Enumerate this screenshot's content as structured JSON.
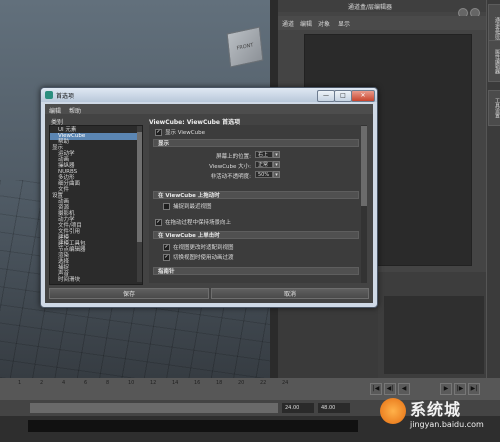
{
  "maya": {
    "outliner_title": "通道盒/层编辑器",
    "outliner_menu": [
      "通道",
      "编辑",
      "对象",
      "显示"
    ],
    "side_tabs": [
      "通道盒/层编辑器",
      "属性编辑器",
      "工具设置"
    ],
    "viewcube_face": "FRONT",
    "timeline_ticks": [
      "1",
      "2",
      "4",
      "6",
      "8",
      "10",
      "12",
      "14",
      "16",
      "18",
      "20",
      "22",
      "24"
    ],
    "range_end": "24.00",
    "range_max": "48.00",
    "playback_buttons": [
      "|◀",
      "◀|",
      "◀",
      "▶",
      "|▶",
      "▶|"
    ]
  },
  "watermark": {
    "site": "系统城",
    "url": "jingyan.baidu.com"
  },
  "dialog": {
    "title": "首选项",
    "menu": [
      "编辑",
      "帮助"
    ],
    "titlebar_buttons": {
      "minimize": "—",
      "maximize": "□",
      "close": "✕"
    },
    "category_label": "类别",
    "categories": [
      {
        "label": "UI 元素",
        "indent": 1,
        "selected": false
      },
      {
        "label": "ViewCube",
        "indent": 1,
        "selected": true
      },
      {
        "label": "帮助",
        "indent": 1,
        "selected": false
      },
      {
        "label": "显示",
        "indent": 0,
        "selected": false
      },
      {
        "label": "运动学",
        "indent": 1,
        "selected": false
      },
      {
        "label": "动画",
        "indent": 1,
        "selected": false
      },
      {
        "label": "操纵器",
        "indent": 1,
        "selected": false
      },
      {
        "label": "NURBS",
        "indent": 1,
        "selected": false
      },
      {
        "label": "多边形",
        "indent": 1,
        "selected": false
      },
      {
        "label": "细分曲面",
        "indent": 1,
        "selected": false
      },
      {
        "label": "文件",
        "indent": 1,
        "selected": false
      },
      {
        "label": "设置",
        "indent": 0,
        "selected": false
      },
      {
        "label": "动画",
        "indent": 1,
        "selected": false
      },
      {
        "label": "资源",
        "indent": 1,
        "selected": false
      },
      {
        "label": "摄影机",
        "indent": 1,
        "selected": false
      },
      {
        "label": "动力学",
        "indent": 1,
        "selected": false
      },
      {
        "label": "文件/项目",
        "indent": 1,
        "selected": false
      },
      {
        "label": "文件引用",
        "indent": 1,
        "selected": false
      },
      {
        "label": "建模",
        "indent": 1,
        "selected": false
      },
      {
        "label": "建模工具包",
        "indent": 1,
        "selected": false
      },
      {
        "label": "节点编辑器",
        "indent": 1,
        "selected": false
      },
      {
        "label": "渲染",
        "indent": 1,
        "selected": false
      },
      {
        "label": "选择",
        "indent": 1,
        "selected": false
      },
      {
        "label": "捕捉",
        "indent": 1,
        "selected": false
      },
      {
        "label": "声音",
        "indent": 1,
        "selected": false
      },
      {
        "label": "时间滑块",
        "indent": 1,
        "selected": false
      }
    ],
    "panel_title": "ViewCube: ViewCube 首选项",
    "show_viewcube": {
      "label": "显示 ViewCube",
      "checked": true
    },
    "display": {
      "header": "显示",
      "position": {
        "label": "屏幕上的位置:",
        "value": "右上"
      },
      "size": {
        "label": "ViewCube 大小:",
        "value": "正常"
      },
      "opacity": {
        "label": "非活动不透明度:",
        "value": "50%"
      }
    },
    "drag_section": {
      "header": "在 ViewCube 上拖动时",
      "snap": {
        "label": "捕捉到最近视图",
        "checked": false
      },
      "keep_upright": {
        "label": "在拖动过程中保持场景向上",
        "checked": true
      }
    },
    "click_section": {
      "header": "在 ViewCube 上单击时",
      "fit_view": {
        "label": "在视图更改时适配到视图",
        "checked": true
      },
      "animate": {
        "label": "切换视图时使用动画过渡",
        "checked": true
      }
    },
    "compass_header": "指南针",
    "buttons": {
      "save": "保存",
      "cancel": "取消"
    }
  }
}
